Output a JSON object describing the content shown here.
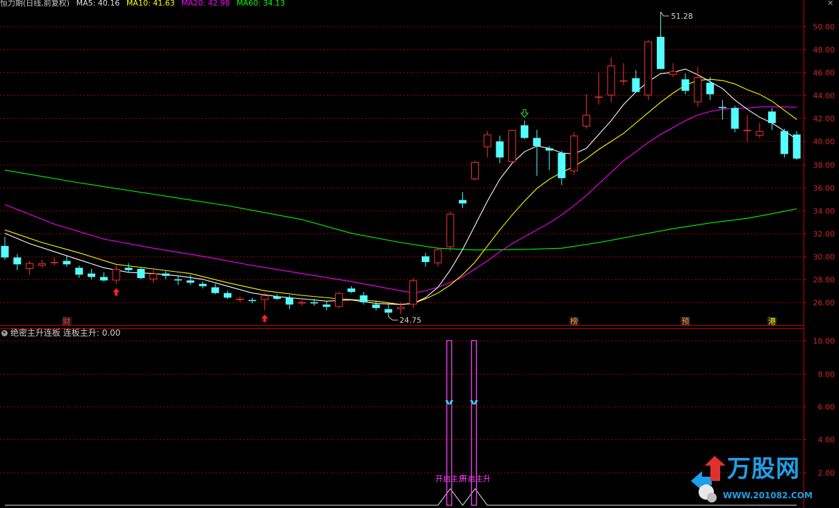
{
  "header": {
    "title": "恒力期(日线,前复权)",
    "ma_items": [
      {
        "label": "MA5: 40.16",
        "color": "#ffffff"
      },
      {
        "label": "MA10: 41.63",
        "color": "#ffff00"
      },
      {
        "label": "MA20: 42.98",
        "color": "#ff00ff"
      },
      {
        "label": "MA60: 34.13",
        "color": "#00ff00"
      }
    ]
  },
  "indicator": {
    "title": "绝密主升连板",
    "value_label": "连板主升: 0.00",
    "signal_label": "开启主升",
    "y_ticks": [
      "10.00",
      "8.00",
      "6.00",
      "4.00",
      "2.00"
    ]
  },
  "colors": {
    "up": "#ff3232",
    "down": "#54ffff",
    "ma5": "#ffffff",
    "ma10": "#ffff00",
    "ma20": "#ff00ff",
    "ma60": "#00ff00",
    "grid": "#a00000",
    "axis": "#c00000",
    "magenta": "#ff40ff"
  },
  "logo": {
    "text": "万股网",
    "url": "WWW.201082.COM"
  },
  "chart_data": {
    "type": "candlestick",
    "y_ticks": [
      26,
      28,
      30,
      32,
      34,
      36,
      38,
      40,
      42,
      44,
      46,
      48,
      50
    ],
    "ylim": [
      24.0,
      51.7
    ],
    "high_label": "51.28",
    "low_label": "24.75",
    "candles": [
      [
        30.9,
        31.7,
        29.7,
        29.9
      ],
      [
        29.9,
        30.2,
        28.8,
        29.3
      ],
      [
        28.9,
        29.6,
        28.4,
        29.4
      ],
      [
        29.2,
        29.7,
        29.0,
        29.4
      ],
      [
        29.5,
        29.9,
        29.2,
        29.5
      ],
      [
        29.6,
        30.1,
        29.1,
        29.3
      ],
      [
        29.0,
        29.2,
        28.1,
        28.4
      ],
      [
        28.5,
        28.9,
        28.0,
        28.2
      ],
      [
        28.2,
        28.6,
        27.8,
        27.9
      ],
      [
        27.9,
        29.2,
        27.6,
        28.9
      ],
      [
        29.0,
        29.4,
        28.6,
        28.8
      ],
      [
        28.9,
        29.0,
        28.0,
        28.1
      ],
      [
        28.0,
        28.8,
        27.7,
        28.5
      ],
      [
        28.5,
        28.7,
        28.0,
        28.3
      ],
      [
        28.0,
        28.3,
        27.5,
        27.9
      ],
      [
        27.9,
        28.4,
        27.5,
        27.7
      ],
      [
        27.6,
        27.8,
        27.2,
        27.4
      ],
      [
        27.3,
        27.6,
        26.7,
        26.8
      ],
      [
        26.8,
        27.0,
        26.3,
        26.4
      ],
      [
        26.2,
        26.5,
        26.0,
        26.3
      ],
      [
        26.2,
        26.4,
        25.9,
        26.1
      ],
      [
        26.2,
        26.8,
        25.3,
        26.6
      ],
      [
        26.5,
        26.7,
        26.2,
        26.3
      ],
      [
        26.4,
        26.6,
        25.4,
        25.8
      ],
      [
        25.9,
        26.2,
        25.7,
        26.0
      ],
      [
        26.0,
        26.3,
        25.7,
        25.9
      ],
      [
        25.8,
        26.1,
        25.3,
        25.6
      ],
      [
        25.6,
        26.9,
        25.5,
        26.8
      ],
      [
        27.2,
        27.4,
        26.8,
        26.9
      ],
      [
        26.6,
        26.9,
        25.8,
        26.0
      ],
      [
        25.8,
        26.1,
        25.3,
        25.5
      ],
      [
        25.4,
        25.8,
        24.7,
        25.1
      ],
      [
        25.4,
        26.0,
        25.0,
        25.6
      ],
      [
        25.8,
        28.1,
        25.5,
        27.9
      ],
      [
        30.0,
        30.3,
        29.1,
        29.5
      ],
      [
        29.4,
        30.8,
        29.1,
        30.6
      ],
      [
        30.8,
        33.9,
        30.4,
        33.7
      ],
      [
        34.9,
        35.6,
        34.2,
        34.6
      ],
      [
        36.7,
        38.3,
        36.6,
        38.2
      ],
      [
        39.5,
        40.9,
        38.6,
        40.6
      ],
      [
        40.0,
        40.5,
        38.1,
        38.6
      ],
      [
        38.2,
        40.9,
        38.1,
        41.0
      ],
      [
        41.4,
        41.8,
        40.2,
        40.3
      ],
      [
        40.3,
        41.0,
        37.0,
        39.6
      ],
      [
        39.4,
        39.6,
        37.5,
        39.2
      ],
      [
        39.0,
        39.2,
        36.2,
        36.8
      ],
      [
        37.4,
        40.8,
        37.1,
        40.5
      ],
      [
        41.3,
        44.1,
        41.1,
        42.3
      ],
      [
        43.9,
        46.0,
        43.2,
        43.9
      ],
      [
        44.0,
        47.3,
        43.4,
        46.6
      ],
      [
        45.3,
        46.8,
        44.9,
        45.3
      ],
      [
        45.5,
        46.2,
        44.3,
        44.3
      ],
      [
        44.0,
        48.8,
        43.6,
        48.7
      ],
      [
        49.1,
        51.28,
        46.4,
        46.3
      ],
      [
        45.8,
        46.8,
        45.6,
        46.1
      ],
      [
        45.4,
        45.9,
        44.1,
        44.4
      ],
      [
        43.4,
        46.5,
        43.0,
        45.6
      ],
      [
        45.1,
        45.6,
        43.6,
        44.1
      ],
      [
        43.0,
        43.6,
        41.9,
        42.9
      ],
      [
        42.9,
        43.1,
        40.8,
        41.1
      ],
      [
        40.9,
        42.3,
        40.0,
        41.0
      ],
      [
        40.5,
        41.6,
        40.3,
        40.9
      ],
      [
        42.6,
        42.9,
        41.0,
        41.6
      ],
      [
        40.9,
        41.1,
        38.6,
        38.9
      ],
      [
        40.6,
        40.9,
        38.4,
        38.5
      ]
    ],
    "ma5": [
      [
        0,
        32.0
      ],
      [
        2,
        31.1
      ],
      [
        4,
        30.4
      ],
      [
        6,
        29.7
      ],
      [
        8,
        29.0
      ],
      [
        10,
        28.6
      ],
      [
        12,
        28.5
      ],
      [
        14,
        28.3
      ],
      [
        16,
        28.0
      ],
      [
        18,
        27.4
      ],
      [
        20,
        26.8
      ],
      [
        22,
        26.5
      ],
      [
        24,
        26.3
      ],
      [
        26,
        26.1
      ],
      [
        28,
        26.2
      ],
      [
        30,
        25.9
      ],
      [
        32,
        25.8
      ],
      [
        33,
        25.9
      ],
      [
        34,
        26.4
      ],
      [
        35,
        27.3
      ],
      [
        36,
        28.8
      ],
      [
        37,
        30.6
      ],
      [
        38,
        32.7
      ],
      [
        39,
        34.8
      ],
      [
        40,
        36.7
      ],
      [
        41,
        38.1
      ],
      [
        42,
        39.1
      ],
      [
        43,
        39.6
      ],
      [
        44,
        39.4
      ],
      [
        45,
        39.0
      ],
      [
        46,
        38.9
      ],
      [
        47,
        39.4
      ],
      [
        48,
        40.6
      ],
      [
        49,
        41.8
      ],
      [
        50,
        43.2
      ],
      [
        51,
        44.3
      ],
      [
        52,
        45.2
      ],
      [
        53,
        45.9
      ],
      [
        54,
        46.0
      ],
      [
        55,
        46.3
      ],
      [
        56,
        45.8
      ],
      [
        57,
        45.2
      ],
      [
        58,
        44.6
      ],
      [
        59,
        43.6
      ],
      [
        60,
        42.8
      ],
      [
        61,
        42.1
      ],
      [
        62,
        41.6
      ],
      [
        63,
        40.9
      ],
      [
        64,
        40.2
      ]
    ],
    "ma10": [
      [
        0,
        32.3
      ],
      [
        3,
        31.2
      ],
      [
        6,
        30.3
      ],
      [
        9,
        29.3
      ],
      [
        12,
        28.9
      ],
      [
        15,
        28.5
      ],
      [
        18,
        27.7
      ],
      [
        21,
        27.0
      ],
      [
        24,
        26.6
      ],
      [
        27,
        26.3
      ],
      [
        30,
        26.1
      ],
      [
        32,
        25.8
      ],
      [
        33,
        25.9
      ],
      [
        34,
        26.3
      ],
      [
        35,
        26.8
      ],
      [
        36,
        27.5
      ],
      [
        37,
        28.4
      ],
      [
        38,
        29.5
      ],
      [
        39,
        30.9
      ],
      [
        40,
        32.3
      ],
      [
        41,
        33.6
      ],
      [
        42,
        34.8
      ],
      [
        43,
        35.9
      ],
      [
        44,
        36.7
      ],
      [
        45,
        37.3
      ],
      [
        46,
        37.8
      ],
      [
        47,
        38.5
      ],
      [
        48,
        39.3
      ],
      [
        49,
        40.0
      ],
      [
        50,
        40.7
      ],
      [
        51,
        41.6
      ],
      [
        52,
        42.5
      ],
      [
        53,
        43.4
      ],
      [
        54,
        44.2
      ],
      [
        55,
        44.9
      ],
      [
        56,
        45.3
      ],
      [
        57,
        45.4
      ],
      [
        58,
        45.3
      ],
      [
        59,
        45.0
      ],
      [
        60,
        44.5
      ],
      [
        61,
        44.1
      ],
      [
        62,
        43.5
      ],
      [
        63,
        42.7
      ],
      [
        64,
        41.9
      ]
    ],
    "ma20": [
      [
        0,
        34.5
      ],
      [
        4,
        32.8
      ],
      [
        8,
        31.5
      ],
      [
        12,
        30.7
      ],
      [
        16,
        30.0
      ],
      [
        20,
        29.2
      ],
      [
        24,
        28.5
      ],
      [
        28,
        27.8
      ],
      [
        30,
        27.4
      ],
      [
        32,
        27.0
      ],
      [
        33,
        26.8
      ],
      [
        34,
        27.0
      ],
      [
        35,
        27.3
      ],
      [
        36,
        27.7
      ],
      [
        37,
        28.2
      ],
      [
        38,
        28.9
      ],
      [
        39,
        29.6
      ],
      [
        40,
        30.4
      ],
      [
        41,
        31.1
      ],
      [
        42,
        31.7
      ],
      [
        43,
        32.3
      ],
      [
        44,
        32.9
      ],
      [
        45,
        33.6
      ],
      [
        46,
        34.4
      ],
      [
        47,
        35.3
      ],
      [
        48,
        36.3
      ],
      [
        49,
        37.3
      ],
      [
        50,
        38.3
      ],
      [
        51,
        39.1
      ],
      [
        52,
        39.9
      ],
      [
        53,
        40.6
      ],
      [
        54,
        41.2
      ],
      [
        55,
        41.8
      ],
      [
        56,
        42.3
      ],
      [
        57,
        42.6
      ],
      [
        58,
        42.8
      ],
      [
        59,
        42.9
      ],
      [
        60,
        42.9
      ],
      [
        61,
        43.0
      ],
      [
        62,
        43.0
      ],
      [
        63,
        43.0
      ],
      [
        64,
        42.98
      ]
    ],
    "ma60": [
      [
        0,
        37.5
      ],
      [
        6,
        36.4
      ],
      [
        12,
        35.4
      ],
      [
        18,
        34.4
      ],
      [
        24,
        33.2
      ],
      [
        28,
        32.0
      ],
      [
        32,
        31.2
      ],
      [
        35,
        30.7
      ],
      [
        38,
        30.55
      ],
      [
        42,
        30.6
      ],
      [
        45,
        30.7
      ],
      [
        48,
        31.2
      ],
      [
        51,
        31.8
      ],
      [
        54,
        32.4
      ],
      [
        57,
        32.9
      ],
      [
        60,
        33.3
      ],
      [
        62,
        33.7
      ],
      [
        64,
        34.13
      ]
    ],
    "red_arrows_up": [
      9,
      21
    ],
    "green_arrow_down": 42,
    "markers": [
      {
        "index": 5,
        "label": "财",
        "color": "#ff3232"
      },
      {
        "index": 46,
        "label": "榜",
        "color": "#ff9c3c"
      },
      {
        "index": 55,
        "label": "预",
        "color": "#ff9c3c"
      },
      {
        "index": 62,
        "label": "港",
        "color": "#ffff00"
      }
    ],
    "indicator_series": {
      "ylim": [
        0,
        10.6
      ],
      "bars": [
        {
          "index": 36,
          "value": 10.0
        },
        {
          "index": 38,
          "value": 10.0
        }
      ],
      "zigzag": [
        [
          0,
          0
        ],
        [
          35,
          0
        ],
        [
          36,
          1.0
        ],
        [
          37,
          0
        ],
        [
          38,
          1.0
        ],
        [
          39,
          0
        ],
        [
          64,
          0
        ]
      ]
    }
  }
}
